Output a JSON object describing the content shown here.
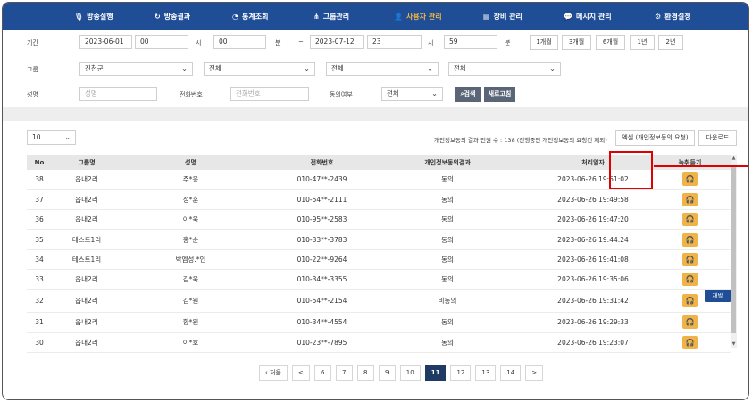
{
  "nav": [
    {
      "icon": "🎙",
      "label": "방송실행"
    },
    {
      "icon": "↻",
      "label": "방송결과"
    },
    {
      "icon": "◔",
      "label": "통계조회"
    },
    {
      "icon": "⋔",
      "label": "그룹관리"
    },
    {
      "icon": "👤",
      "label": "사용자 관리"
    },
    {
      "icon": "▤",
      "label": "장비 관리"
    },
    {
      "icon": "💬",
      "label": "메시지 관리"
    },
    {
      "icon": "⚙",
      "label": "환경설정"
    }
  ],
  "filters": {
    "period_label": "기간",
    "start_date": "2023-06-01",
    "start_hour": "00",
    "hour_unit": "시",
    "start_min": "00",
    "min_unit": "분",
    "tilde": "~",
    "end_date": "2023-07-12",
    "end_hour": "23",
    "end_min": "59",
    "quick": [
      "1개월",
      "3개월",
      "6개월",
      "1년",
      "2년"
    ],
    "group_label": "그룹",
    "group_selects": [
      "진천군",
      "전체",
      "전체",
      "전체"
    ],
    "name_label": "성명",
    "name_placeholder": "성명",
    "phone_label": "전화번호",
    "phone_placeholder": "전화번호",
    "consent_label": "동의여부",
    "consent_value": "전체",
    "search_btn": "검색",
    "refresh_btn": "새로고침"
  },
  "list": {
    "page_size": "10",
    "summary": "개인정보동의 결과 인원 수 : 138  (진행중인 개인정보동의 요청건 제외)",
    "excel_btn": "엑셀 (개인정보동의 요청)",
    "download_btn": "다운로드",
    "headers": [
      "No",
      "그룹명",
      "성명",
      "전화번호",
      "개인정보동의결과",
      "처리일자",
      "녹취듣기"
    ],
    "resend_label": "재발송",
    "rows": [
      {
        "no": "38",
        "group": "읍내2리",
        "name": "주*응",
        "phone": "010-47**-2439",
        "result": "동의",
        "date": "2023-06-26 19:51:02",
        "resend": false
      },
      {
        "no": "37",
        "group": "읍내2리",
        "name": "정*훈",
        "phone": "010-54**-2111",
        "result": "동의",
        "date": "2023-06-26 19:49:58",
        "resend": false
      },
      {
        "no": "36",
        "group": "읍내2리",
        "name": "이*욱",
        "phone": "010-95**-2583",
        "result": "동의",
        "date": "2023-06-26 19:47:20",
        "resend": false
      },
      {
        "no": "35",
        "group": "테스트1리",
        "name": "홍*순",
        "phone": "010-33**-3783",
        "result": "동의",
        "date": "2023-06-26 19:44:24",
        "resend": false
      },
      {
        "no": "34",
        "group": "테스트1리",
        "name": "박엠성.*인",
        "phone": "010-22**-9264",
        "result": "동의",
        "date": "2023-06-26 19:41:08",
        "resend": false
      },
      {
        "no": "33",
        "group": "읍내2리",
        "name": "김*욱",
        "phone": "010-34**-3355",
        "result": "동의",
        "date": "2023-06-26 19:35:06",
        "resend": false
      },
      {
        "no": "32",
        "group": "읍내2리",
        "name": "김*원",
        "phone": "010-54**-2154",
        "result": "비동의",
        "date": "2023-06-26 19:31:42",
        "resend": true
      },
      {
        "no": "31",
        "group": "읍내2리",
        "name": "황*원",
        "phone": "010-34**-4554",
        "result": "동의",
        "date": "2023-06-26 19:29:33",
        "resend": false
      },
      {
        "no": "30",
        "group": "읍내2리",
        "name": "이*호",
        "phone": "010-23**-7895",
        "result": "동의",
        "date": "2023-06-26 19:23:07",
        "resend": false
      }
    ]
  },
  "pager": {
    "first": "‹ 처음",
    "prev": "<",
    "pages": [
      "6",
      "7",
      "8",
      "9",
      "10",
      "11",
      "12",
      "13",
      "14"
    ],
    "current": "11",
    "next": ">"
  },
  "colors": {
    "nav_bg": "#1f4e96",
    "active": "#f3b642",
    "record": "#f0b347",
    "highlight": "#e00000"
  }
}
